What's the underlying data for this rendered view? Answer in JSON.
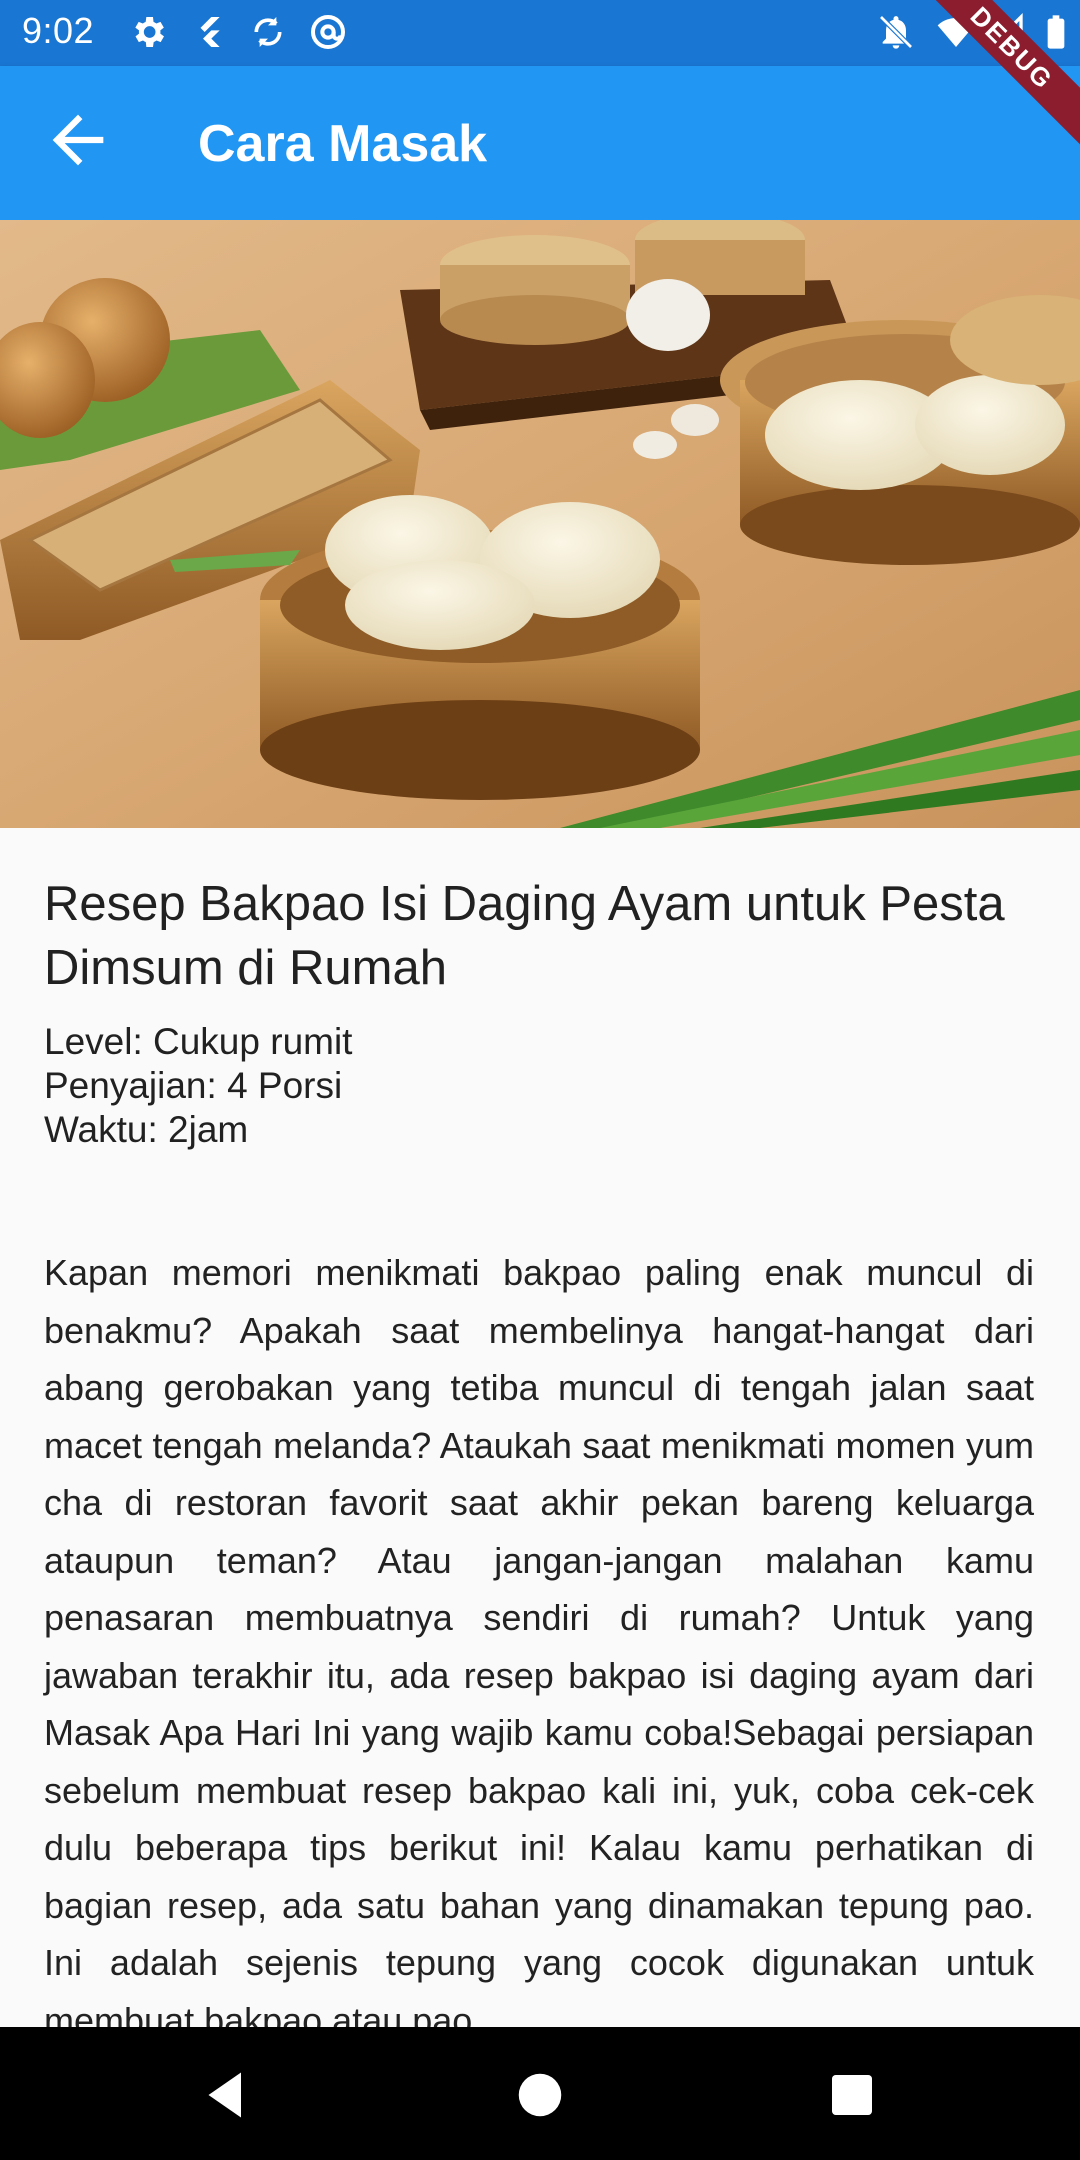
{
  "status_bar": {
    "time": "9:02",
    "left_icons": [
      "gear-icon",
      "flutter-icon",
      "sync-icon",
      "at-sign-icon"
    ],
    "right_icons": [
      "notifications-off-icon",
      "wifi-icon",
      "signal-icon",
      "battery-icon"
    ]
  },
  "app_bar": {
    "title": "Cara Masak",
    "back_icon": "arrow-back-icon",
    "debug_banner": "DEBUG"
  },
  "recipe": {
    "title": "Resep Bakpao Isi Daging Ayam untuk Pesta Dimsum di Rumah",
    "level": "Level: Cukup rumit",
    "servings": "Penyajian: 4 Porsi",
    "time": "Waktu: 2jam",
    "description": "Kapan memori menikmati bakpao paling enak muncul di benakmu? Apakah saat membelinya hangat-hangat dari abang gerobakan yang tetiba muncul di tengah jalan saat macet tengah melanda? Ataukah saat menikmati momen yum cha di restoran favorit saat akhir pekan bareng keluarga ataupun teman? Atau jangan-jangan malahan kamu penasaran membuatnya sendiri di rumah? Untuk yang jawaban terakhir itu, ada resep bakpao isi daging ayam dari Masak Apa Hari Ini yang wajib kamu coba!Sebagai persiapan sebelum membuat resep bakpao kali ini, yuk, coba cek-cek dulu beberapa tips berikut ini! Kalau kamu perhatikan di bagian resep, ada satu bahan yang dinamakan tepung pao. Ini adalah sejenis tepung yang cocok digunakan untuk membuat bakpao atau pao."
  },
  "nav_bar": {
    "icons": [
      "back-triangle-icon",
      "home-circle-icon",
      "recents-square-icon"
    ]
  },
  "colors": {
    "status_bar": "#1976d2",
    "app_bar": "#2196f3",
    "debug_banner": "#8c1d2e",
    "background": "#fafafa",
    "nav_bar": "#000000"
  }
}
